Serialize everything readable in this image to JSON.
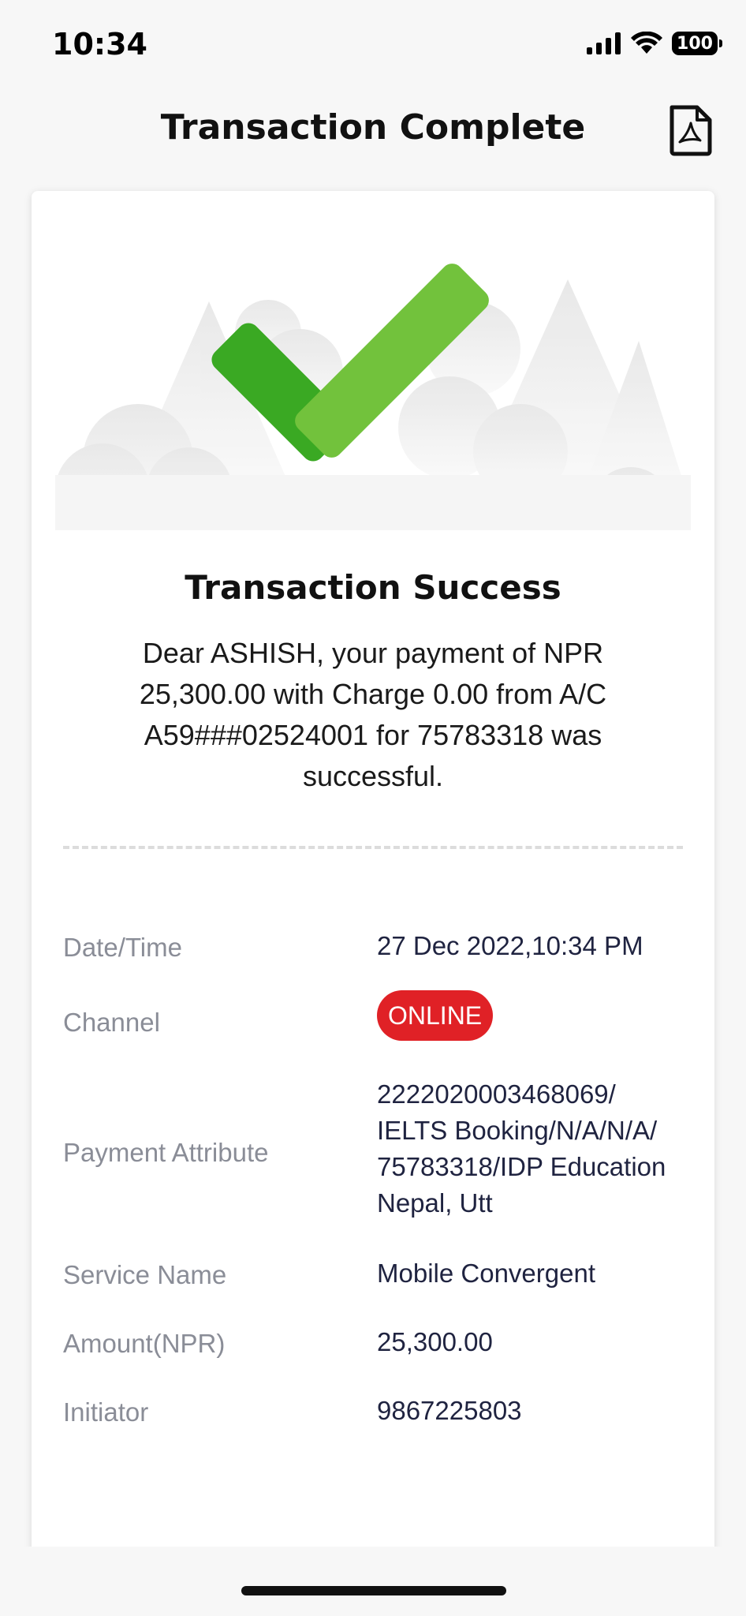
{
  "status_bar": {
    "time": "10:34",
    "battery": "100",
    "signal_icon": "cellular-signal-icon",
    "wifi_icon": "wifi-icon"
  },
  "header": {
    "title": "Transaction Complete",
    "pdf_icon": "pdf-icon"
  },
  "result": {
    "icon": "checkmark-icon",
    "title": "Transaction Success",
    "message": "Dear ASHISH, your payment of NPR 25,300.00 with Charge 0.00 from A/C A59###02524001 for 75783318 was successful."
  },
  "details": [
    {
      "label": "Date/Time",
      "value": "27 Dec 2022,10:34 PM"
    },
    {
      "label": "Channel",
      "value": "ONLINE"
    },
    {
      "label": "Payment Attribute",
      "value": "2222020003468069/ IELTS Booking/N/A/N/A/ 75783318/IDP Education Nepal, Utt"
    },
    {
      "label": "Service Name",
      "value": "Mobile Convergent"
    },
    {
      "label": "Amount(NPR)",
      "value": "25,300.00"
    },
    {
      "label": "Initiator",
      "value": "9867225803"
    }
  ],
  "colors": {
    "success_green": "#6cbf3c",
    "success_green_dark": "#3aa923",
    "channel_badge": "#e02126",
    "label_gray": "#8a8d97",
    "value_dark": "#1f2340"
  }
}
